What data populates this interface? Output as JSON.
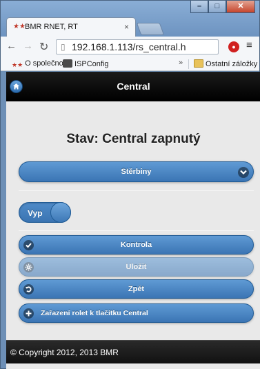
{
  "browser": {
    "tab_title": "BMR RNET, RT",
    "tab_close": "×",
    "url": "192.168.1.113/rs_central.h",
    "bookmarks": [
      {
        "label": "O společnosti"
      },
      {
        "label": "ISPConfig"
      }
    ],
    "bookmarks_more": "»",
    "other_bookmarks": "Ostatní záložky"
  },
  "header": {
    "title": "Central"
  },
  "status_text": "Stav: Central zapnutý",
  "select": {
    "selected": "Stěrbiny"
  },
  "toggle": {
    "label": "Vyp",
    "state": "off"
  },
  "buttons": [
    {
      "label": "Kontrola",
      "icon": "check-icon",
      "enabled": true
    },
    {
      "label": "Uložit",
      "icon": "gear-icon",
      "enabled": false
    },
    {
      "label": "Zpět",
      "icon": "back-icon",
      "enabled": true
    },
    {
      "label": "Zařazení rolet k tlačítku Central",
      "icon": "plus-icon",
      "enabled": true
    }
  ],
  "footer": {
    "text": "© Copyright 2012, 2013 BMR"
  },
  "colors": {
    "accent": "#3b75b4",
    "header_bg": "#000000",
    "page_bg": "#e9e9e9"
  }
}
